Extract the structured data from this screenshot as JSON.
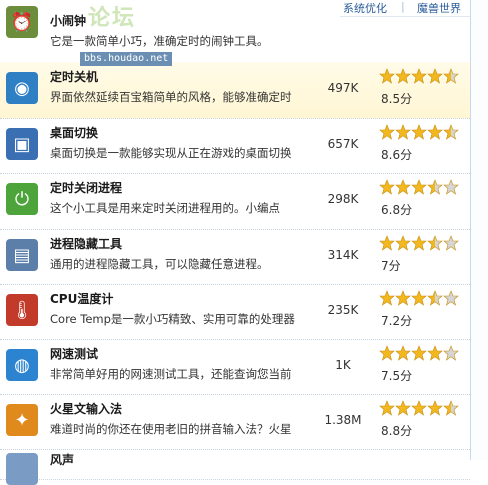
{
  "top_links": [
    "系统优化",
    "|",
    "魔兽世界"
  ],
  "watermark": {
    "text": "论坛",
    "url": "bbs.houdao.net"
  },
  "items": [
    {
      "name": "icon-alarm",
      "title": "小闹钟",
      "desc": "它是一款简单小巧，准确定时的闹钟工具。",
      "count": "",
      "rating": 0,
      "score": "",
      "color": "#6b8d3c",
      "glyph": "⏰",
      "icon": "alarm-clock-icon"
    },
    {
      "name": "icon-shutdown",
      "title": "定时关机",
      "desc": "界面依然延续百宝箱简单的风格，能够准确定时",
      "count": "497K",
      "rating": 4.5,
      "score": "8.5分",
      "color": "#2f7fc4",
      "glyph": "◉",
      "icon": "shutdown-timer-icon"
    },
    {
      "name": "icon-desktop",
      "title": "桌面切换",
      "desc": "桌面切换是一款能够实现从正在游戏的桌面切换",
      "count": "657K",
      "rating": 4.5,
      "score": "8.6分",
      "color": "#3a6fb4",
      "glyph": "▣",
      "icon": "desktop-switch-icon"
    },
    {
      "name": "icon-process",
      "title": "定时关闭进程",
      "desc": "这个小工具是用来定时关闭进程用的。小编点",
      "count": "298K",
      "rating": 3.5,
      "score": "6.8分",
      "color": "#4ca43a",
      "glyph": "⏻",
      "icon": "close-process-icon"
    },
    {
      "name": "icon-hide",
      "title": "进程隐藏工具",
      "desc": "通用的进程隐藏工具，可以隐藏任意进程。",
      "count": "314K",
      "rating": 3.5,
      "score": "7分",
      "color": "#5b7fa8",
      "glyph": "▤",
      "icon": "hide-process-icon"
    },
    {
      "name": "icon-cpu",
      "title": "CPU温度计",
      "desc": "Core Temp是一款小巧精致、实用可靠的处理器",
      "count": "235K",
      "rating": 3.5,
      "score": "7.2分",
      "color": "#c23b2a",
      "glyph": "🌡",
      "icon": "thermometer-icon"
    },
    {
      "name": "icon-speed",
      "title": "网速测试",
      "desc": "非常简单好用的网速测试工具，还能查询您当前",
      "count": "1K",
      "rating": 4,
      "score": "7.5分",
      "color": "#2c84d0",
      "glyph": "◍",
      "icon": "network-speed-icon"
    },
    {
      "name": "icon-mars",
      "title": "火星文输入法",
      "desc": "难道时尚的你还在使用老旧的拼音输入法？火星",
      "count": "1.38M",
      "rating": 4.5,
      "score": "8.8分",
      "color": "#e08a1e",
      "glyph": "✦",
      "icon": "mars-input-icon"
    },
    {
      "name": "icon-next",
      "title": "风声",
      "desc": "",
      "count": "",
      "rating": 0,
      "score": "",
      "color": "#7a9cc4",
      "glyph": "",
      "icon": "next-item-icon"
    }
  ]
}
